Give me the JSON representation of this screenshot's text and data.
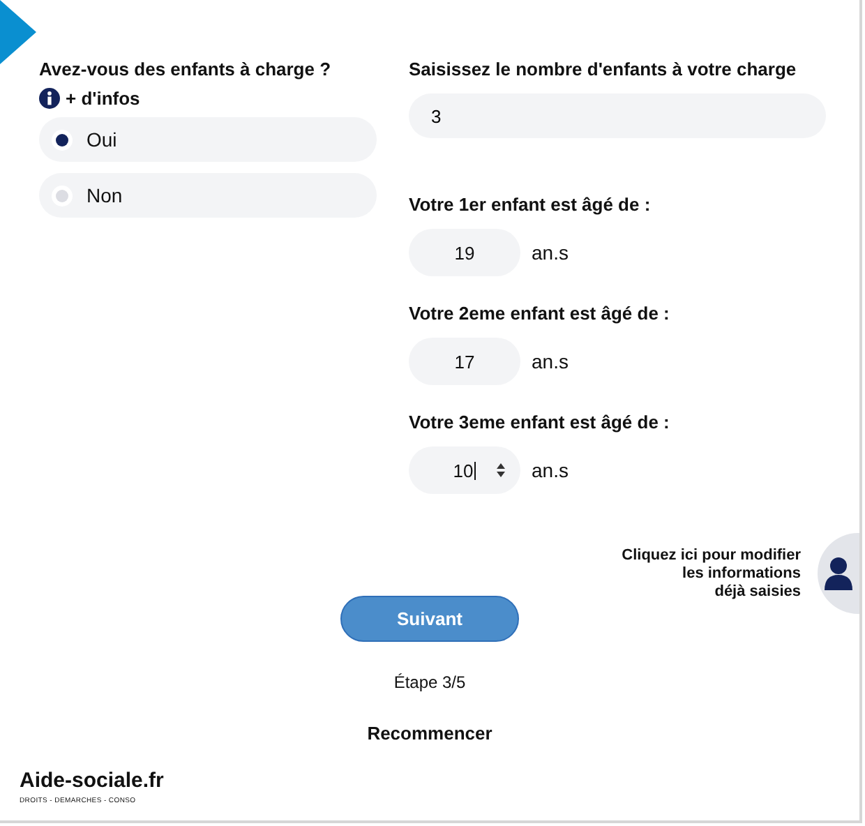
{
  "question": {
    "label": "Avez-vous des enfants à charge ?",
    "info_link": "+ d'infos",
    "options": [
      {
        "label": "Oui",
        "selected": true
      },
      {
        "label": "Non",
        "selected": false
      }
    ]
  },
  "count": {
    "label": "Saisissez le nombre d'enfants à votre charge",
    "value": "3"
  },
  "children": [
    {
      "label": "Votre 1er enfant est âgé de :",
      "value": "19",
      "unit": "an.s",
      "focused": false
    },
    {
      "label": "Votre 2eme enfant est âgé de :",
      "value": "17",
      "unit": "an.s",
      "focused": false
    },
    {
      "label": "Votre 3eme enfant est âgé de :",
      "value": "10",
      "unit": "an.s",
      "focused": true
    }
  ],
  "edit_hint": [
    "Cliquez ici pour modifier",
    "les informations",
    "déjà saisies"
  ],
  "next_button": "Suivant",
  "step": "Étape 3/5",
  "restart": "Recommencer",
  "logo": {
    "name": "Aide-sociale.fr",
    "tagline": "DROITS - DEMARCHES - CONSO"
  }
}
